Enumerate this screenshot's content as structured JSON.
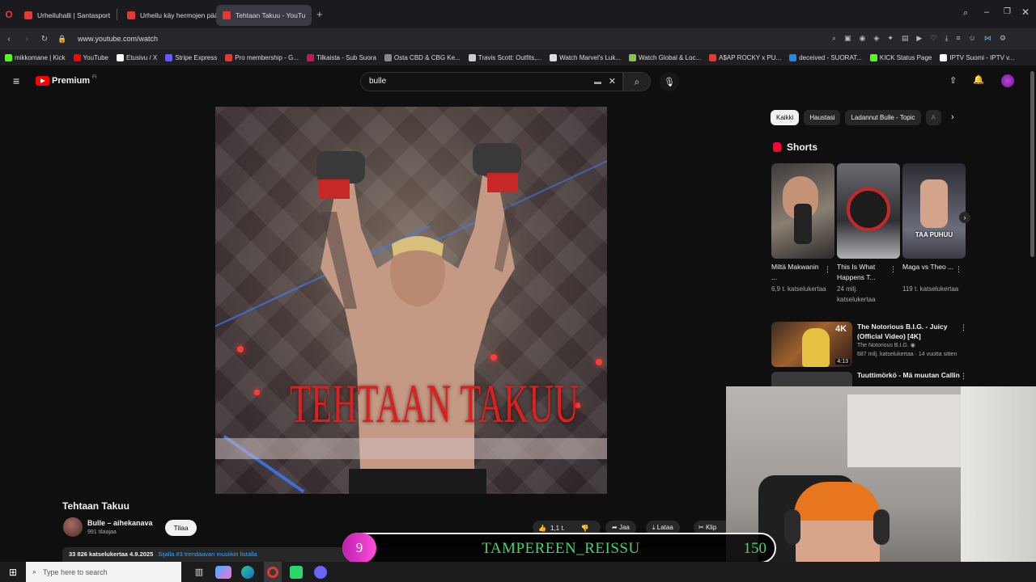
{
  "browser": {
    "tabs": [
      {
        "title": "Urheiluhalli | Santasport",
        "color": "#e53935"
      },
      {
        "title": "Urheilu käy hermojen pää",
        "color": "#e53935"
      },
      {
        "title": "Tehtaan Takuu - YouTu",
        "color": "#e53935"
      }
    ],
    "url": "www.youtube.com/watch",
    "bookmarks": [
      {
        "label": "mikkomane | Kick",
        "color": "#53fc18"
      },
      {
        "label": "YouTube",
        "color": "#ff0000"
      },
      {
        "label": "Etusivu / X",
        "color": "#ffffff"
      },
      {
        "label": "Stripe Express",
        "color": "#635bff"
      },
      {
        "label": "Pro membership - G...",
        "color": "#e53935"
      },
      {
        "label": "Tilkaista - Sub Suora",
        "color": "#c2185b"
      },
      {
        "label": "Osta CBD & CBG Ke...",
        "color": "#888888"
      },
      {
        "label": "Travis Scott: Outfits,...",
        "color": "#cccccc"
      },
      {
        "label": "Watch Marvel's Luk...",
        "color": "#dddddd"
      },
      {
        "label": "Watch Global & Loc...",
        "color": "#8bc34a"
      },
      {
        "label": "A$AP ROCKY x PU...",
        "color": "#e53935"
      },
      {
        "label": "deceived - SUORAT...",
        "color": "#1e88e5"
      },
      {
        "label": "KICK Status Page",
        "color": "#53fc18"
      },
      {
        "label": "IPTV Suomi - IPTV v...",
        "color": "#ffffff"
      }
    ]
  },
  "youtube": {
    "logo_text": "Premium",
    "logo_region": "FI",
    "search_value": "bulle",
    "video": {
      "thumbnail_text": "TEHTAAN TAKUU",
      "title": "Tehtaan Takuu",
      "channel": "Bulle – aihekanava",
      "subscribers": "991 tilaajaa",
      "subscribe_label": "Tilaa",
      "likes": "1,1 t.",
      "share_label": "Jaa",
      "download_label": "Lataa",
      "clip_label": "Klip",
      "views_date": "33 826 katselukertaa  4.9.2025",
      "trending": "Sijalla #3 trendaavan musiikin listalla"
    },
    "chips": [
      {
        "label": "Kaikki",
        "active": true
      },
      {
        "label": "Haustasi",
        "active": false
      },
      {
        "label": "Ladannut Bulle - Topic",
        "active": false
      },
      {
        "label": "A",
        "active": false
      }
    ],
    "shorts_title": "Shorts",
    "shorts": [
      {
        "title": "Miltä Makwanin ...",
        "views": "6,9 t. katselukertaa",
        "overlay": ""
      },
      {
        "title": "This Is What Happens T...",
        "views": "24 milj. katselukertaa",
        "overlay": ""
      },
      {
        "title": "Maga vs Theo ...",
        "views": "119 t. katselukertaa",
        "overlay": "TAA PUHUU"
      }
    ],
    "recommendations": [
      {
        "title": "The Notorious B.I.G. - Juicy (Official Video) [4K]",
        "channel": "The Notorious B.I.G.",
        "meta": "687 milj. katselukertaa · 14 vuotta sitten",
        "badge": "4K",
        "duration": "4:13"
      },
      {
        "title": "Tuuttimörkö - Mä muutan Callin",
        "channel": "",
        "meta": "",
        "badge": "",
        "duration": ""
      }
    ]
  },
  "overlay": {
    "rank": "9",
    "name": "TAMPEREEN_REISSU",
    "count": "150"
  },
  "taskbar": {
    "search_placeholder": "Type here to search"
  }
}
